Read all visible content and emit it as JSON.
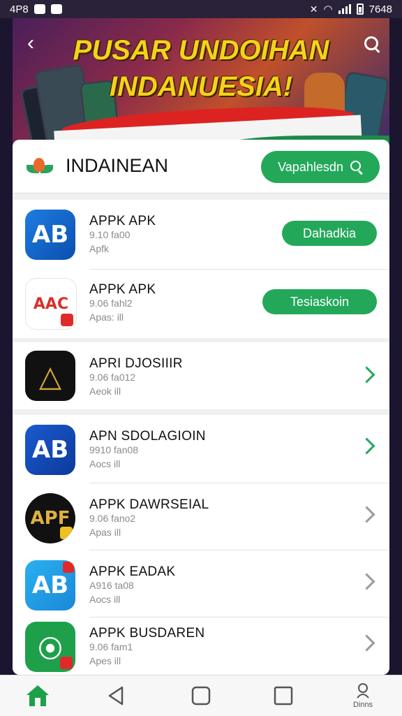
{
  "status_bar": {
    "left_time": "4P8",
    "right_time": "7648",
    "icons": [
      "notification-icon",
      "photo-icon",
      "mute-icon",
      "wifi-icon",
      "signal-icon",
      "battery-icon"
    ]
  },
  "banner": {
    "title_line1": "PUSAR UNDOIHAN",
    "title_line2": "INDANUESIA!",
    "back_icon": "back-arrow-icon",
    "search_icon": "search-icon"
  },
  "header": {
    "title": "INDAINEAN",
    "search_button_label": "Vapahlesdn",
    "logo": "leaf-logo-icon"
  },
  "apps_top": [
    {
      "name": "APPK APK",
      "line1": "9.10  fa00",
      "line2": "Apfk",
      "action": "Dahadkia",
      "icon_text": "AB",
      "icon_style": "blue"
    },
    {
      "name": "APPK APK",
      "line1": "9.06  fahl2",
      "line2": "Apas:    ill",
      "action": "Tesiaskoin",
      "icon_text": "AAC",
      "icon_style": "white"
    }
  ],
  "apps_middle": [
    {
      "name": "APRI DJOSIIIR",
      "line1": "9.06  fa012",
      "line2": "Aeok     ill",
      "icon_text": "△",
      "icon_style": "black-gold"
    }
  ],
  "apps_bottom": [
    {
      "name": "APN SDOLAGIOIN",
      "line1": "9910  fan08",
      "line2": "Aocs     ill",
      "icon_text": "AB",
      "icon_style": "blue-dark",
      "chevron": "green"
    },
    {
      "name": "APPK DAWRSEIAL",
      "line1": "9.06  fano2",
      "line2": "Apas     ill",
      "icon_text": "APF",
      "icon_style": "black-gold2",
      "chevron": "gray"
    },
    {
      "name": "APPK EADAK",
      "line1": "A916  ta08",
      "line2": "Aocs     ill",
      "icon_text": "AB",
      "icon_style": "light-blue",
      "chevron": "gray"
    },
    {
      "name": "APPK BUSDAREN",
      "line1": "9.06  fam1",
      "line2": "Apes     ill",
      "icon_text": "⦿",
      "icon_style": "green",
      "chevron": "gray"
    }
  ],
  "bottom_nav": {
    "items": [
      "home-icon",
      "back-triangle-icon",
      "square-icon",
      "recents-square-icon",
      "profile-icon"
    ],
    "last_label": "Dinns"
  },
  "colors": {
    "accent_green": "#23a85a",
    "banner_yellow": "#f5d21a",
    "chevron_green": "#23a85a"
  }
}
